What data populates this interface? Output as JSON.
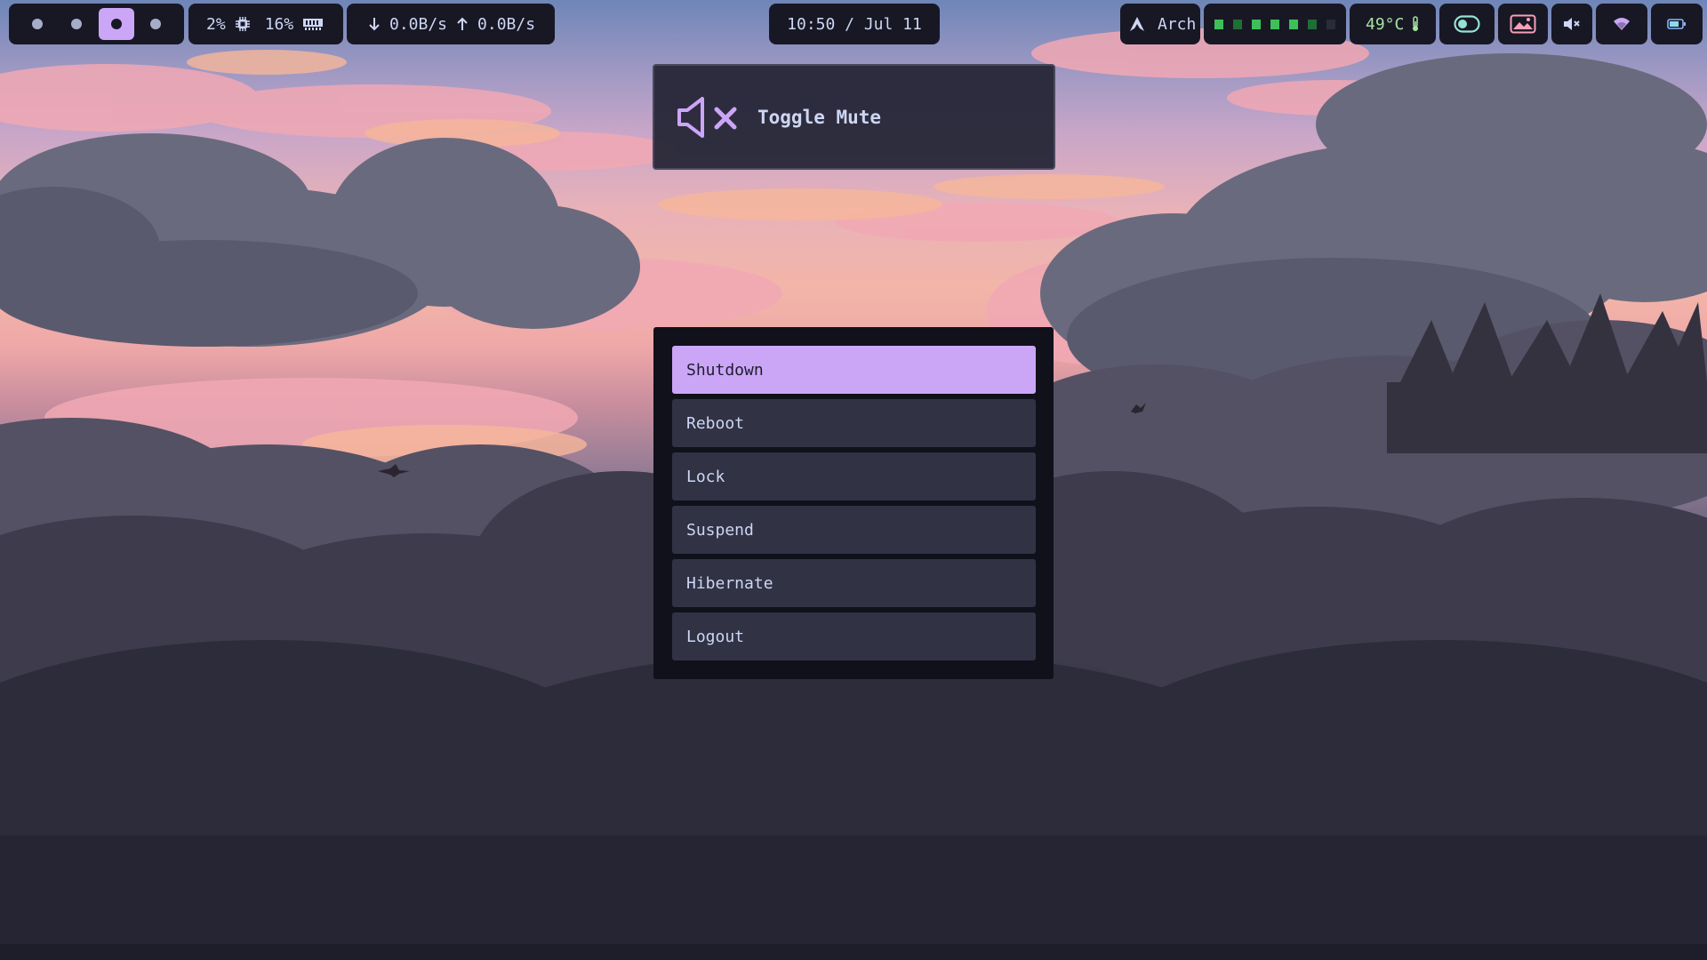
{
  "topbar": {
    "workspaces": [
      {
        "id": 1,
        "active": false
      },
      {
        "id": 2,
        "active": false
      },
      {
        "id": 3,
        "active": true
      },
      {
        "id": 4,
        "active": false
      }
    ],
    "cpu_usage": "2%",
    "mem_usage": "16%",
    "net_down": "0.0B/s",
    "net_up": "0.0B/s",
    "clock": "10:50 / Jul 11",
    "os_name": "Arch",
    "visualizer_levels": [
      "on",
      "dim",
      "on",
      "on",
      "on",
      "dim",
      "off"
    ],
    "temperature": "49°C"
  },
  "osd": {
    "label": "Toggle Mute",
    "icon": "speaker-muted-icon"
  },
  "power_menu": {
    "items": [
      {
        "label": "Shutdown",
        "selected": true
      },
      {
        "label": "Reboot",
        "selected": false
      },
      {
        "label": "Lock",
        "selected": false
      },
      {
        "label": "Suspend",
        "selected": false
      },
      {
        "label": "Hibernate",
        "selected": false
      },
      {
        "label": "Logout",
        "selected": false
      }
    ]
  },
  "colors": {
    "accent": "#cba6f7",
    "bar_bg": "#181825",
    "menu_bg": "#11111b",
    "item_bg": "#313244",
    "text": "#cdd6f4",
    "temp_text": "#a6e3a1",
    "visualizer": "#3fbf5a"
  }
}
